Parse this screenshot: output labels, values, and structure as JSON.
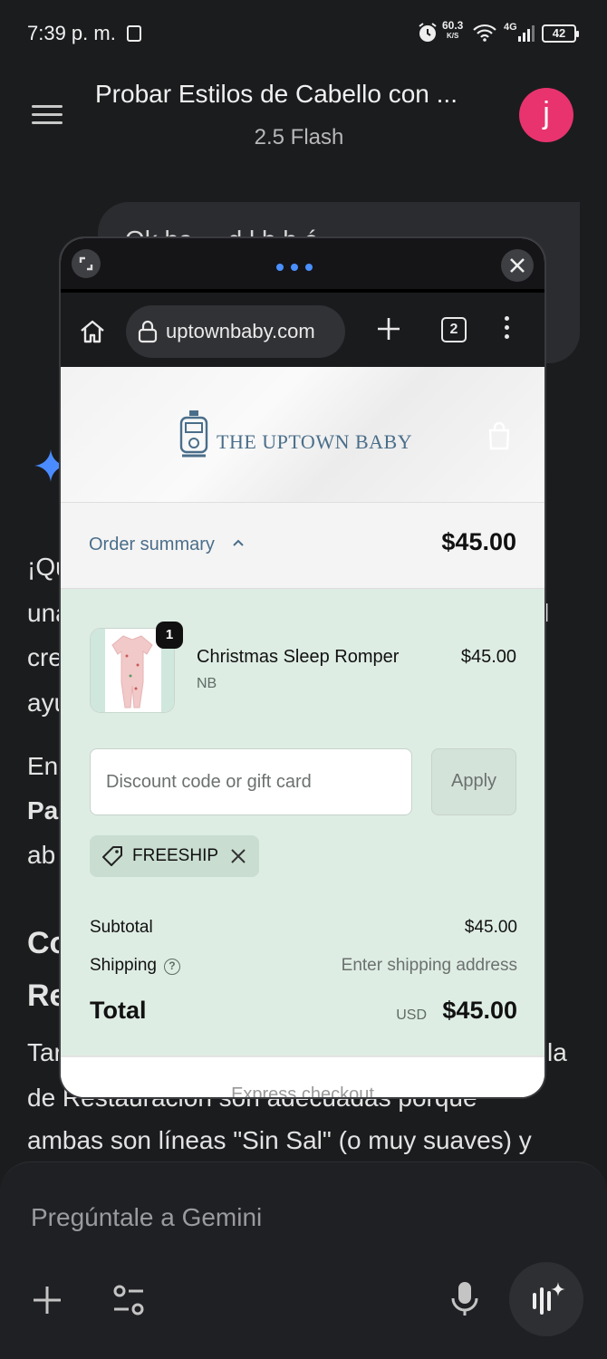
{
  "status_bar": {
    "time": "7:39 p. m.",
    "speed_value": "60.3",
    "speed_unit": "K/S",
    "network": "4G",
    "battery": "42"
  },
  "header": {
    "title": "Probar Estilos de Cabello con ...",
    "model": "2.5 Flash",
    "avatar_letter": "j"
  },
  "chat": {
    "user_message_partial": "Ok ha ... d l b h é",
    "response_lines": [
      {
        "text": "¡Qu",
        "bold": false
      },
      {
        "text": "una",
        "right": "l"
      },
      {
        "text": "cre"
      },
      {
        "text": "ayu"
      },
      {
        "text": "En"
      },
      {
        "text": "Pa"
      },
      {
        "text": "ab"
      },
      {
        "text": "Co"
      },
      {
        "text": "Re"
      },
      {
        "text": "Tar",
        "right": "la"
      },
      {
        "text": "de Restauración son adecuadas porque"
      },
      {
        "text": "ambas son líneas \"Sin Sal\" (o muy suaves) y"
      }
    ]
  },
  "input": {
    "placeholder": "Pregúntale a Gemini"
  },
  "browser": {
    "url": "uptownbaby.com",
    "tab_count": "2"
  },
  "store": {
    "name": "THE UPTOWN BABY",
    "order_summary_label": "Order summary",
    "order_total": "$45.00",
    "item": {
      "name": "Christmas Sleep Romper",
      "variant": "NB",
      "price": "$45.00",
      "quantity": "1"
    },
    "discount_placeholder": "Discount code or gift card",
    "apply_label": "Apply",
    "applied_code": "FREESHIP",
    "subtotal_label": "Subtotal",
    "subtotal_value": "$45.00",
    "shipping_label": "Shipping",
    "shipping_value": "Enter shipping address",
    "total_label": "Total",
    "currency": "USD",
    "total_value": "$45.00",
    "express_checkout": "Express checkout"
  },
  "colors": {
    "accent_blue": "#4a90ff",
    "avatar_pink": "#e8336e",
    "order_panel": "#deede4",
    "brand_blue": "#4a6e8a"
  }
}
